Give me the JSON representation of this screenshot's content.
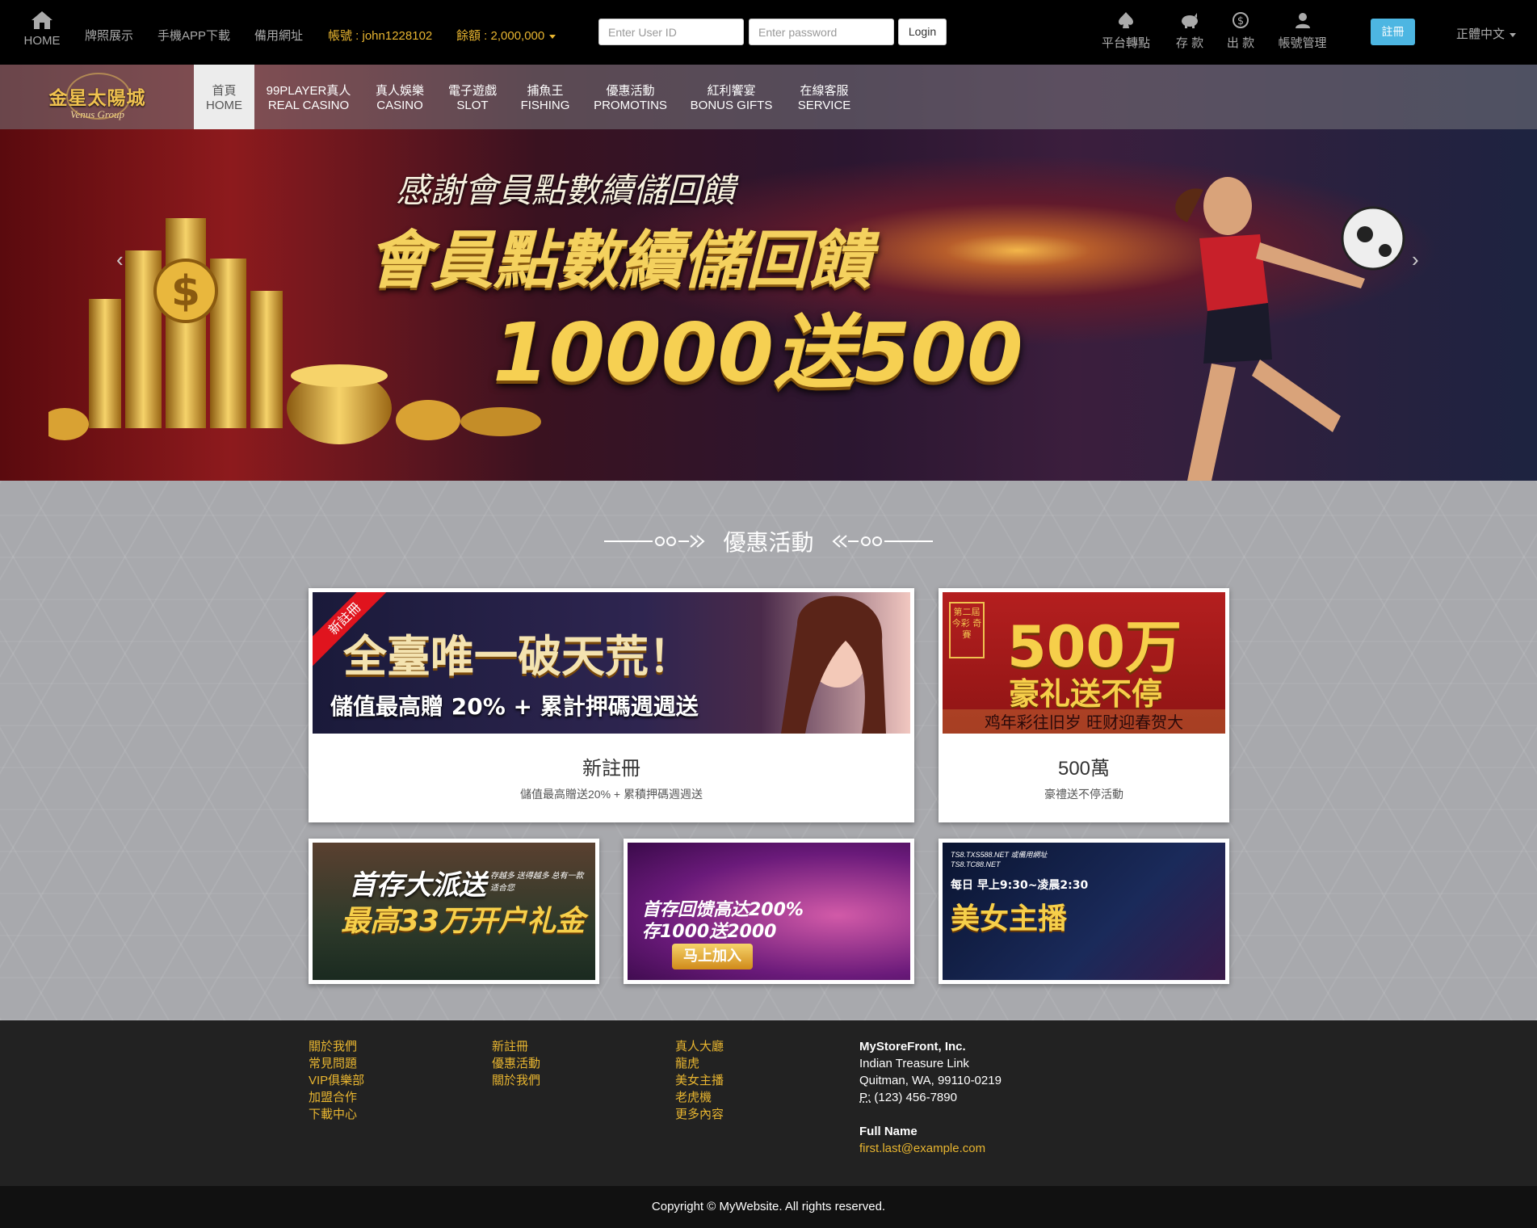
{
  "topbar": {
    "home_label": "HOME",
    "links": [
      "牌照展示",
      "手機APP下載",
      "備用網址"
    ],
    "account": "帳號 : john1228102",
    "balance": "餘額 : 2,000,000",
    "userid_placeholder": "Enter User ID",
    "password_placeholder": "Enter password",
    "login_label": "Login",
    "icons": [
      {
        "label": "平台轉點",
        "icon": "spade-icon"
      },
      {
        "label": "存 款",
        "icon": "piggy-bank-icon"
      },
      {
        "label": "出 款",
        "icon": "dollar-icon"
      },
      {
        "label": "帳號管理",
        "icon": "user-icon"
      }
    ],
    "register_label": "註冊",
    "language": "正體中文"
  },
  "nav": {
    "logo_main": "金星太陽城",
    "logo_sub": "Venus Group",
    "items": [
      {
        "zh": "首頁",
        "en": "HOME",
        "active": true
      },
      {
        "zh": "99PLAYER真人",
        "en": "REAL CASINO"
      },
      {
        "zh": "真人娛樂",
        "en": "CASINO"
      },
      {
        "zh": "電子遊戲",
        "en": "SLOT"
      },
      {
        "zh": "捕魚王",
        "en": "FISHING"
      },
      {
        "zh": "優惠活動",
        "en": "PROMOTINS"
      },
      {
        "zh": "紅利饗宴",
        "en": "BONUS GIFTS"
      },
      {
        "zh": "在線客服",
        "en": "SERVICE"
      }
    ]
  },
  "banner": {
    "line1": "感謝會員點數續儲回饋",
    "line2": "會員點數續儲回饋",
    "line3": "10000送500",
    "prev": "‹",
    "next": "›",
    "slides": 3,
    "active_slide": 2
  },
  "promotions": {
    "title": "優惠活動",
    "cards": [
      {
        "ribbon": "新註冊",
        "img_headline": "全臺唯一破天荒！",
        "img_sub": "儲值最高贈 20% + 累計押碼週週送",
        "title": "新註冊",
        "desc": "儲值最高贈送20% + 累積押碼週週送"
      },
      {
        "img_badge": "第二屆 今彩 奇賽",
        "img_headline": "500万",
        "img_sub": "豪礼送不停",
        "img_foot": "鸡年彩往旧岁 旺财迎春贺大",
        "title": "500萬",
        "desc": "豪禮送不停活動"
      }
    ],
    "small_cards": [
      {
        "line1": "首存大派送",
        "line2": "最高33万开户礼金",
        "side": "存越多 送得越多 总有一款适合您"
      },
      {
        "line1": "首存回馈高达200%",
        "line2": "存1000送2000",
        "button": "马上加入"
      },
      {
        "top1": "TS8.TXS588.NET 或備用網址",
        "top2": "TS8.TC88.NET",
        "line1": "每日 早上9:30~凌晨2:30",
        "line2": "美女主播"
      }
    ]
  },
  "footer": {
    "col1": [
      "關於我們",
      "常見問題",
      "VIP俱樂部",
      "加盟合作",
      "下載中心"
    ],
    "col2": [
      "新註冊",
      "優惠活動",
      "關於我們"
    ],
    "col3": [
      "真人大廳",
      "龍虎",
      "美女主播",
      "老虎機",
      "更多內容"
    ],
    "address": {
      "company": "MyStoreFront, Inc.",
      "street": "Indian Treasure Link",
      "city": "Quitman, WA, 99110-0219",
      "phone_label": "P:",
      "phone": "(123) 456-7890",
      "contact_title": "Full Name",
      "email": "first.last@example.com"
    },
    "copyright": "Copyright © MyWebsite. All rights reserved."
  },
  "colors": {
    "accent_gold": "#e8b530",
    "register_blue": "#4db6e2",
    "footer_bg": "#222222"
  }
}
